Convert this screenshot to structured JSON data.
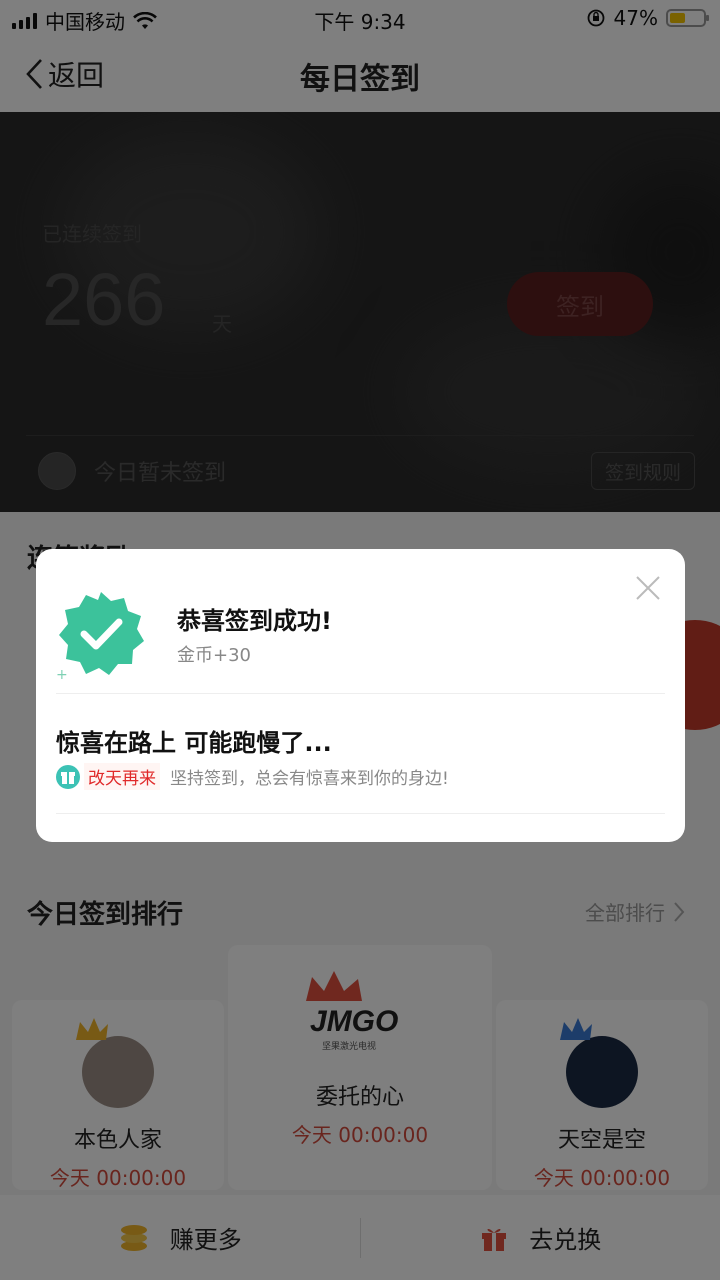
{
  "status_bar": {
    "carrier": "中国移动",
    "time": "下午 9:34",
    "battery": "47%",
    "battery_level": 0.47
  },
  "nav": {
    "back_label": "返回",
    "title": "每日签到"
  },
  "hero": {
    "streak_label": "已连续签到",
    "streak_days": "266",
    "streak_unit": "天",
    "checkin_button": "签到",
    "today_status": "今日暂未签到",
    "rules_button": "签到规则"
  },
  "sections": {
    "reward_title": "连签奖励",
    "ranking_title": "今日签到排行",
    "ranking_link": "全部排行"
  },
  "ranking": [
    {
      "name": "本色人家",
      "time": "今天 00:00:00"
    },
    {
      "name": "委托的心",
      "time": "今天 00:00:00"
    },
    {
      "name": "天空是空",
      "time": "今天 00:00:00"
    }
  ],
  "jmgo": {
    "logo": "JMGO",
    "tagline": "坚果激光电视"
  },
  "bottom_bar": {
    "earn_label": "赚更多",
    "exchange_label": "去兑换"
  },
  "modal": {
    "title": "恭喜签到成功!",
    "coin_text": "金币+30",
    "subtitle": "惊喜在路上 可能跑慢了...",
    "tag": "改天再来",
    "tip": "坚持签到，总会有惊喜来到你的身边!"
  },
  "colors": {
    "accent_red": "#e02a2a",
    "badge_green": "#3cc29b",
    "modal_bg": "#ffffff"
  }
}
